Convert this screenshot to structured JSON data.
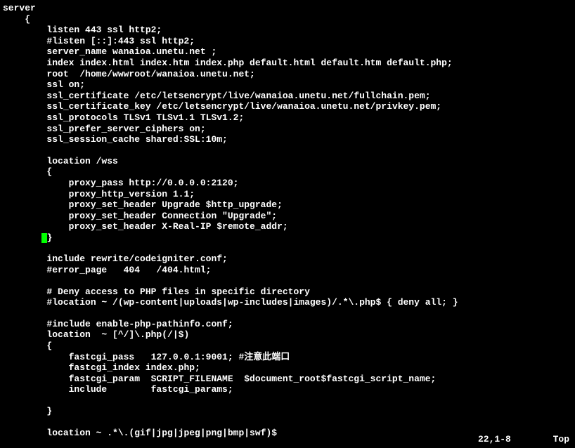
{
  "config_lines": [
    "server",
    "    {",
    "        listen 443 ssl http2;",
    "        #listen [::]:443 ssl http2;",
    "        server_name wanaioa.unetu.net ;",
    "        index index.html index.htm index.php default.html default.htm default.php;",
    "        root  /home/wwwroot/wanaioa.unetu.net;",
    "        ssl on;",
    "        ssl_certificate /etc/letsencrypt/live/wanaioa.unetu.net/fullchain.pem;",
    "        ssl_certificate_key /etc/letsencrypt/live/wanaioa.unetu.net/privkey.pem;",
    "        ssl_protocols TLSv1 TLSv1.1 TLSv1.2;",
    "        ssl_prefer_server_ciphers on;",
    "        ssl_session_cache shared:SSL:10m;",
    "",
    "        location /wss",
    "        {",
    "            proxy_pass http://0.0.0.0:2120;",
    "            proxy_http_version 1.1;",
    "            proxy_set_header Upgrade $http_upgrade;",
    "            proxy_set_header Connection \"Upgrade\";",
    "            proxy_set_header X-Real-IP $remote_addr;",
    "",
    "",
    "        include rewrite/codeigniter.conf;",
    "        #error_page   404   /404.html;",
    "",
    "        # Deny access to PHP files in specific directory",
    "        #location ~ /(wp-content|uploads|wp-includes|images)/.*\\.php$ { deny all; }",
    "",
    "        #include enable-php-pathinfo.conf;",
    "        location  ~ [^/]\\.php(/|$)",
    "        {",
    "            fastcgi_pass   127.0.0.1:9001; #注意此端口",
    "            fastcgi_index index.php;",
    "            fastcgi_param  SCRIPT_FILENAME  $document_root$fastcgi_script_name;",
    "            include        fastcgi_params;",
    "",
    "        }",
    "",
    "        location ~ .*\\.(gif|jpg|jpeg|png|bmp|swf)$"
  ],
  "cursor_line_index": 21,
  "cursor_prefix": "       ",
  "cursor_brace": "}",
  "status": {
    "position": "22,1-8",
    "view": "Top"
  }
}
